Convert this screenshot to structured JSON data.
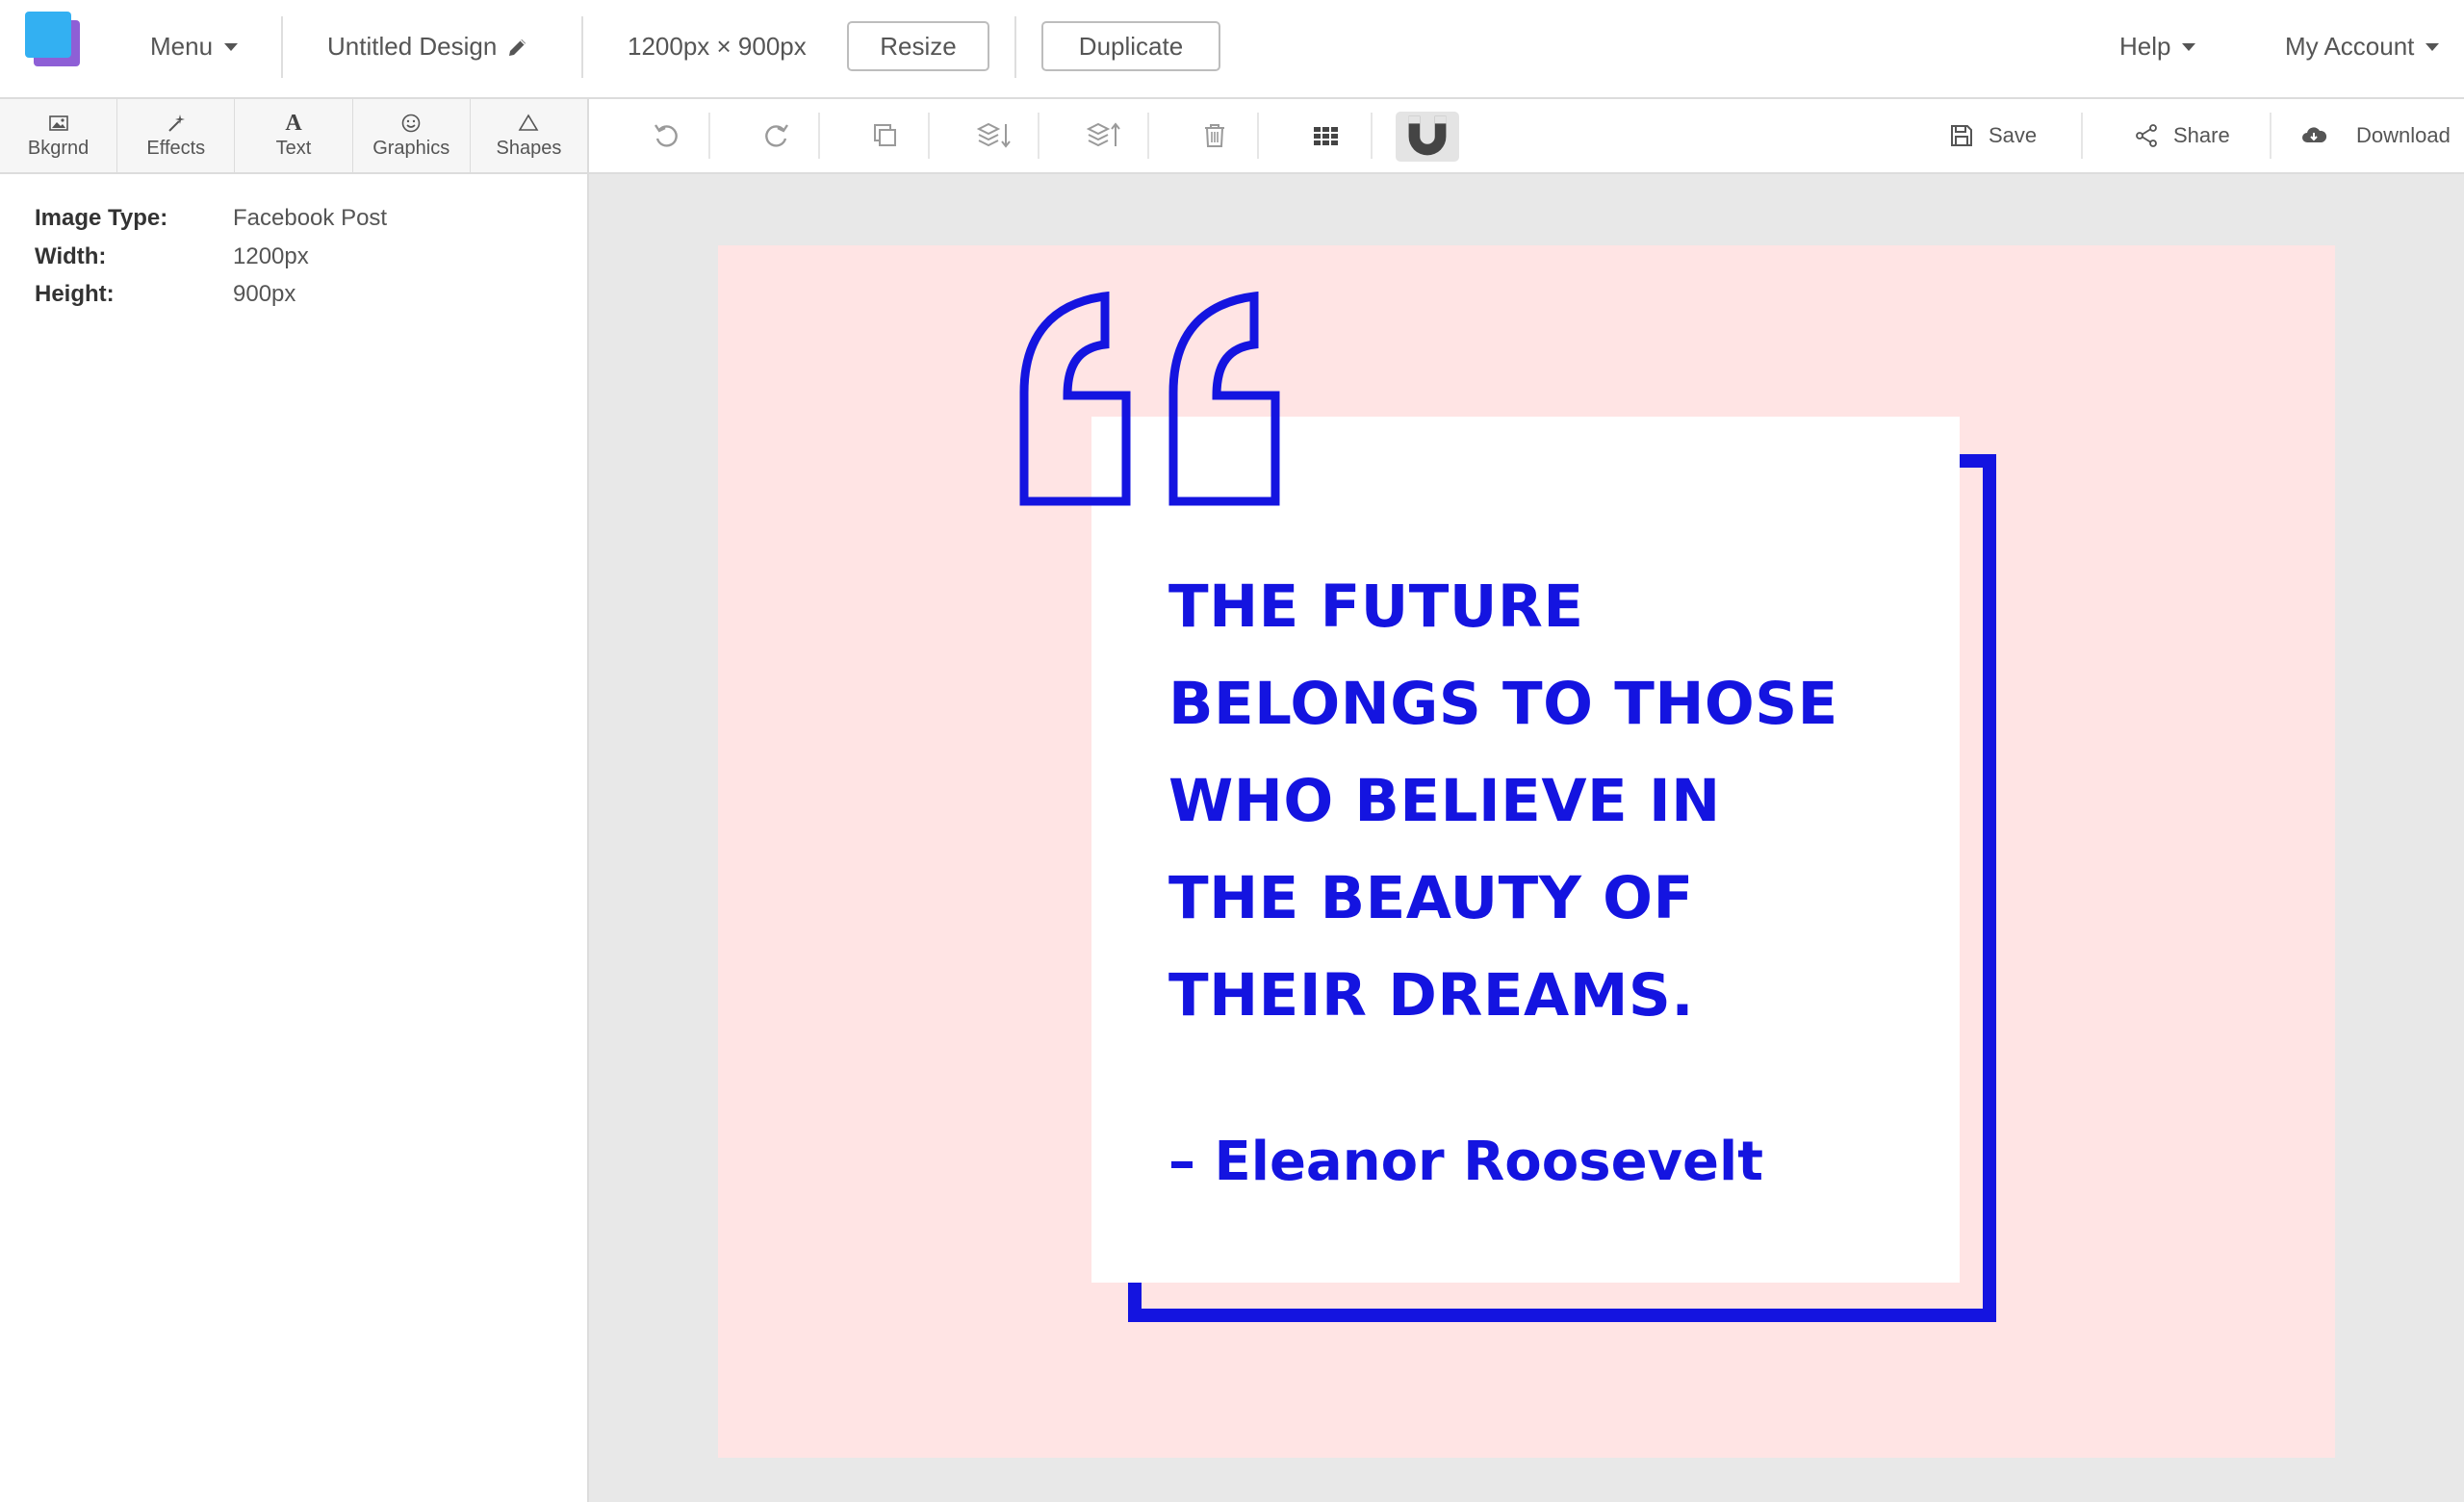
{
  "header": {
    "menu_label": "Menu",
    "design_title": "Untitled Design",
    "dimensions": "1200px × 900px",
    "resize_label": "Resize",
    "duplicate_label": "Duplicate",
    "help_label": "Help",
    "account_label": "My Account"
  },
  "tools": [
    {
      "label": "Bkgrnd",
      "icon": "image-icon"
    },
    {
      "label": "Effects",
      "icon": "magic-wand-icon"
    },
    {
      "label": "Text",
      "icon": "text-icon"
    },
    {
      "label": "Graphics",
      "icon": "smiley-icon"
    },
    {
      "label": "Shapes",
      "icon": "triangle-icon"
    }
  ],
  "actions": {
    "save_label": "Save",
    "share_label": "Share",
    "download_label": "Download",
    "icons": [
      "undo-icon",
      "redo-icon",
      "copy-icon",
      "send-backward-icon",
      "bring-forward-icon",
      "trash-icon",
      "grid-icon",
      "magnet-icon"
    ]
  },
  "panel": {
    "image_type_label": "Image Type:",
    "image_type_value": "Facebook Post",
    "width_label": "Width:",
    "width_value": "1200px",
    "height_label": "Height:",
    "height_value": "900px"
  },
  "design": {
    "quote_lines": [
      "THE FUTURE",
      "BELONGS TO THOSE",
      "WHO BELIEVE IN",
      "THE BEAUTY OF",
      "THEIR DREAMS."
    ],
    "author": "– Eleanor Roosevelt",
    "colors": {
      "background": "#ffe4e4",
      "accent": "#1414e0",
      "card": "#ffffff"
    }
  }
}
